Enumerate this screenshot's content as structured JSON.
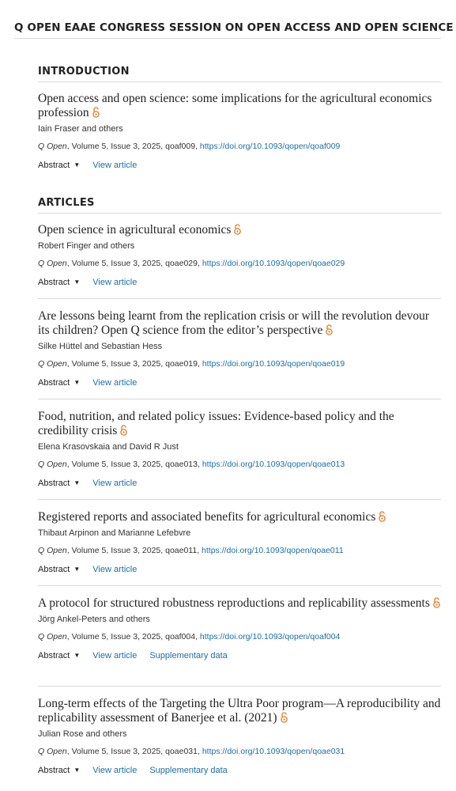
{
  "page_heading": "Q OPEN EAAE CONGRESS SESSION ON OPEN ACCESS AND OPEN SCIENCE",
  "sections": [
    {
      "heading": "INTRODUCTION",
      "articles": [
        {
          "title": "Open access and open science: some implications for the agricultural economics profession",
          "authors": "Iain Fraser and others",
          "journal": "Q Open",
          "citation_rest": ", Volume 5, Issue 3, 2025, qoaf009, ",
          "doi": "https://doi.org/10.1093/qopen/qoaf009",
          "abstract_label": "Abstract",
          "view_label": "View article",
          "supplementary_label": ""
        }
      ]
    },
    {
      "heading": "ARTICLES",
      "articles": [
        {
          "title": "Open science in agricultural economics",
          "authors": "Robert Finger and others",
          "journal": "Q Open",
          "citation_rest": ", Volume 5, Issue 3, 2025, qoae029, ",
          "doi": "https://doi.org/10.1093/qopen/qoae029",
          "abstract_label": "Abstract",
          "view_label": "View article",
          "supplementary_label": ""
        },
        {
          "title": "Are lessons being learnt from the replication crisis or will the revolution devour its children? Open Q science from the editor’s perspective",
          "authors": "Silke Hüttel and Sebastian Hess",
          "journal": "Q Open",
          "citation_rest": ", Volume 5, Issue 3, 2025, qoae019, ",
          "doi": "https://doi.org/10.1093/qopen/qoae019",
          "abstract_label": "Abstract",
          "view_label": "View article",
          "supplementary_label": ""
        },
        {
          "title": "Food, nutrition, and related policy issues: Evidence-based policy and the credibility crisis",
          "authors": "Elena Krasovskaia and David R Just",
          "journal": "Q Open",
          "citation_rest": ", Volume 5, Issue 3, 2025, qoae013, ",
          "doi": "https://doi.org/10.1093/qopen/qoae013",
          "abstract_label": "Abstract",
          "view_label": "View article",
          "supplementary_label": ""
        },
        {
          "title": "Registered reports and associated benefits for agricultural economics",
          "authors": "Thibaut Arpinon and Marianne Lefebvre",
          "journal": "Q Open",
          "citation_rest": ", Volume 5, Issue 3, 2025, qoae011, ",
          "doi": "https://doi.org/10.1093/qopen/qoae011",
          "abstract_label": "Abstract",
          "view_label": "View article",
          "supplementary_label": ""
        },
        {
          "title": "A protocol for structured robustness reproductions and replicability assessments",
          "authors": "Jörg Ankel-Peters and others",
          "journal": "Q Open",
          "citation_rest": ", Volume 5, Issue 3, 2025, qoaf004, ",
          "doi": "https://doi.org/10.1093/qopen/qoaf004",
          "abstract_label": "Abstract",
          "view_label": "View article",
          "supplementary_label": "Supplementary data"
        },
        {
          "title": "Long-term effects of the Targeting the Ultra Poor program—A reproducibility and replicability assessment of Banerjee et al. (2021)",
          "authors": "Julian Rose and others",
          "journal": "Q Open",
          "citation_rest": ", Volume 5, Issue 3, 2025, qoae031, ",
          "doi": "https://doi.org/10.1093/qopen/qoae031",
          "abstract_label": "Abstract",
          "view_label": "View article",
          "supplementary_label": "Supplementary data"
        }
      ]
    }
  ],
  "icons": {
    "open_access": "open-access-lock-icon",
    "caret": "caret-down-icon"
  },
  "colors": {
    "link": "#1a6fa6",
    "open_access": "#e07b22",
    "text": "#222222",
    "rule": "#d8d8d8"
  }
}
